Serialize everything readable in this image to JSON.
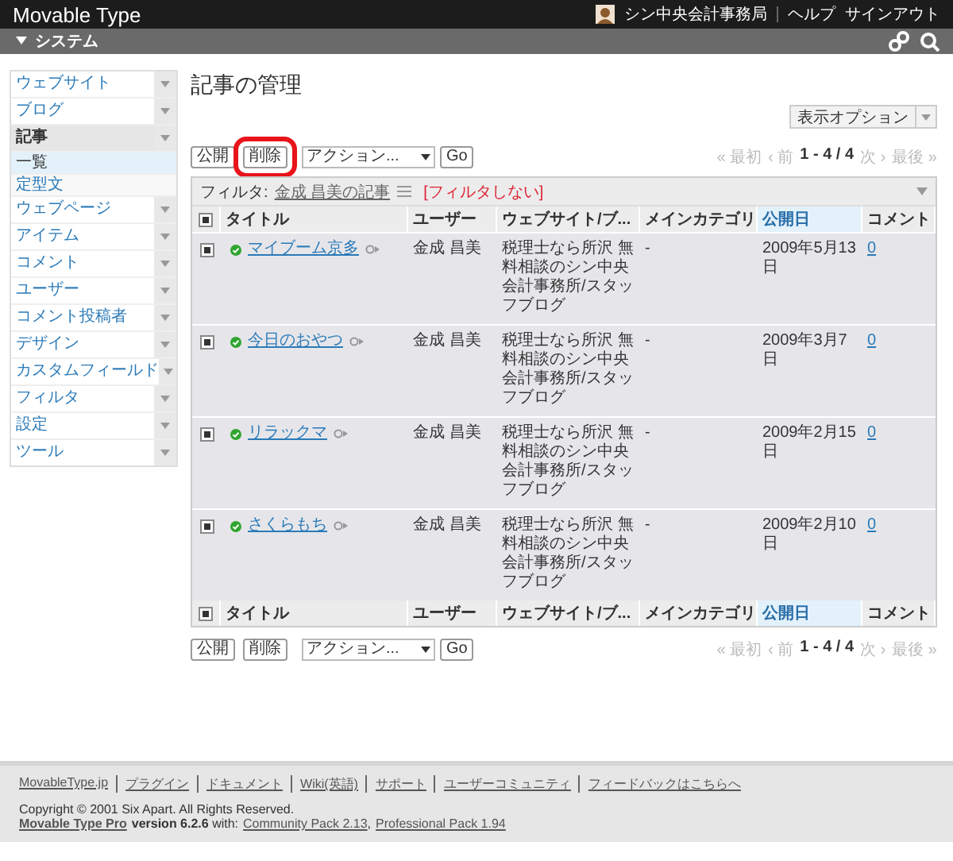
{
  "header": {
    "app_title": "Movable Type",
    "user": "シン中央会計事務局",
    "links": [
      "ヘルプ",
      "サインアウト"
    ]
  },
  "scope_bar": {
    "label": "システム"
  },
  "sidebar": {
    "items": [
      {
        "label": "ウェブサイト",
        "expanded": false
      },
      {
        "label": "ブログ",
        "expanded": false
      },
      {
        "label": "記事",
        "expanded": true,
        "children": [
          {
            "label": "一覧",
            "selected": true
          },
          {
            "label": "定型文",
            "selected": false
          }
        ]
      },
      {
        "label": "ウェブページ",
        "expanded": false
      },
      {
        "label": "アイテム",
        "expanded": false
      },
      {
        "label": "コメント",
        "expanded": false
      },
      {
        "label": "ユーザー",
        "expanded": false
      },
      {
        "label": "コメント投稿者",
        "expanded": false
      },
      {
        "label": "デザイン",
        "expanded": false
      },
      {
        "label": "カスタムフィールド",
        "expanded": false
      },
      {
        "label": "フィルタ",
        "expanded": false
      },
      {
        "label": "設定",
        "expanded": false
      },
      {
        "label": "ツール",
        "expanded": false
      }
    ]
  },
  "page_title": "記事の管理",
  "display_options": "表示オプション",
  "toolbars": [
    {
      "buttons": [
        {
          "label": "公開",
          "highlighted": false
        },
        {
          "label": "削除",
          "highlighted": true
        }
      ],
      "action": "アクション...",
      "go": "Go",
      "pager": [
        {
          "label": "« 最初",
          "disabled": true
        },
        {
          "label": "‹ 前",
          "disabled": true
        },
        {
          "label": "1 - 4 / 4",
          "disabled": false
        },
        {
          "label": "次 ›",
          "disabled": true
        },
        {
          "label": "最後 »",
          "disabled": true
        }
      ]
    },
    {
      "buttons": [
        {
          "label": "公開",
          "highlighted": false
        },
        {
          "label": "削除",
          "highlighted": false
        }
      ],
      "action": "アクション...",
      "go": "Go",
      "pager": [
        {
          "label": "« 最初",
          "disabled": true
        },
        {
          "label": "‹ 前",
          "disabled": true
        },
        {
          "label": "1 - 4 / 4",
          "disabled": false
        },
        {
          "label": "次 ›",
          "disabled": true
        },
        {
          "label": "最後 »",
          "disabled": true
        }
      ]
    }
  ],
  "filter": {
    "label": "フィルタ:",
    "name": "金成 昌美の記事",
    "clear": "[フィルタしない]"
  },
  "table": {
    "header_checked": true,
    "columns": [
      {
        "label": "タイトル",
        "selected": false
      },
      {
        "label": "ユーザー",
        "selected": false
      },
      {
        "label": "ウェブサイト/ブ...",
        "selected": false
      },
      {
        "label": "メインカテゴリ",
        "selected": false
      },
      {
        "label": "公開日",
        "selected": true
      },
      {
        "label": "コメント",
        "selected": false
      }
    ],
    "footer_columns": [
      {
        "label": "タイトル",
        "selected": false
      },
      {
        "label": "ユーザー",
        "selected": false
      },
      {
        "label": "ウェブサイト/ブ...",
        "selected": false
      },
      {
        "label": "メインカテゴリ",
        "selected": false
      },
      {
        "label": "公開日",
        "selected": true
      },
      {
        "label": "コメント",
        "selected": false
      }
    ],
    "rows": [
      {
        "checked": true,
        "published": true,
        "title": "マイブーム京多",
        "user": "金成 昌美",
        "site": "税理士なら所沢 無料相談のシン中央会計事務所/スタッフブログ",
        "category": "-",
        "date": "2009年5月13日",
        "comments": "0"
      },
      {
        "checked": true,
        "published": true,
        "title": "今日のおやつ",
        "user": "金成 昌美",
        "site": "税理士なら所沢 無料相談のシン中央会計事務所/スタッフブログ",
        "category": "-",
        "date": "2009年3月7日",
        "comments": "0"
      },
      {
        "checked": true,
        "published": true,
        "title": "リラックマ",
        "user": "金成 昌美",
        "site": "税理士なら所沢 無料相談のシン中央会計事務所/スタッフブログ",
        "category": "-",
        "date": "2009年2月15日",
        "comments": "0"
      },
      {
        "checked": true,
        "published": true,
        "title": "さくらもち",
        "user": "金成 昌美",
        "site": "税理士なら所沢 無料相談のシン中央会計事務所/スタッフブログ",
        "category": "-",
        "date": "2009年2月10日",
        "comments": "0"
      }
    ]
  },
  "footer": {
    "links": [
      "MovableType.jp",
      "プラグイン",
      "ドキュメント",
      "Wiki(英語)",
      "サポート",
      "ユーザーコミュニティ",
      "フィードバックはこちらへ"
    ],
    "copyright": "Copyright © 2001 Six Apart. All Rights Reserved.",
    "product": "Movable Type Pro",
    "version": "**version 6.2.6** with:",
    "packs": [
      "Community Pack 2.13",
      "Professional Pack 1.94"
    ],
    "pack_separator": ","
  }
}
